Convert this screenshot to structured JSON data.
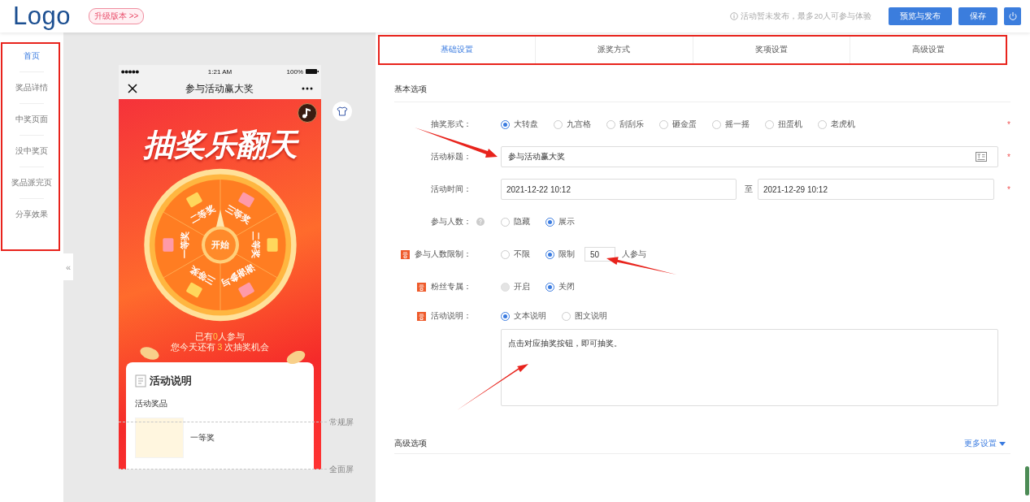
{
  "header": {
    "logo": "Logo",
    "upgrade_badge": "升级版本 >>",
    "notice": "活动暂未发布，最多20人可参与体验",
    "buttons": [
      "预览与发布",
      "保存"
    ]
  },
  "sidebar": {
    "items": [
      {
        "label": "首页",
        "selected": true
      },
      {
        "label": "奖品详情",
        "selected": false
      },
      {
        "label": "中奖页面",
        "selected": false
      },
      {
        "label": "没中奖页",
        "selected": false
      },
      {
        "label": "奖品派完页",
        "selected": false
      },
      {
        "label": "分享效果",
        "selected": false
      }
    ],
    "collapse": "«"
  },
  "preview": {
    "phone": {
      "status_time": "1:21 AM",
      "battery": "100%",
      "title": "参与活动赢大奖",
      "banner_title": "抽奖乐翻天",
      "prizes": [
        "二等奖",
        "三等奖",
        "二等奖",
        "谢谢参与",
        "三等奖",
        "一等奖"
      ],
      "start": "开始",
      "participants": {
        "before": "已有",
        "count": "0",
        "after": "人参与"
      },
      "chances": {
        "before": "您今天还有 ",
        "count": "3",
        "after": " 次抽奖机会"
      },
      "card": {
        "title": "活动说明",
        "subtitle": "活动奖品",
        "prize": "一等奖"
      }
    },
    "screen_marks": [
      "常规屏",
      "全面屏"
    ]
  },
  "tabs": [
    {
      "label": "基础设置",
      "selected": true
    },
    {
      "label": "派奖方式",
      "selected": false
    },
    {
      "label": "奖项设置",
      "selected": false
    },
    {
      "label": "高级设置",
      "selected": false
    }
  ],
  "form": {
    "title": "基本选项",
    "rows": [
      {
        "kind": "radio",
        "label": "抽奖形式：",
        "badge": false,
        "help": false,
        "required_mark": "*",
        "options": [
          {
            "label": "大转盘",
            "selected": true,
            "disabled": false
          },
          {
            "label": "九宫格",
            "selected": false,
            "disabled": false
          },
          {
            "label": "刮刮乐",
            "selected": false,
            "disabled": false
          },
          {
            "label": "砸金蛋",
            "selected": false,
            "disabled": false
          },
          {
            "label": "摇一摇",
            "selected": false,
            "disabled": false
          },
          {
            "label": "扭蛋机",
            "selected": false,
            "disabled": false
          },
          {
            "label": "老虎机",
            "selected": false,
            "disabled": false
          }
        ]
      },
      {
        "kind": "text",
        "label": "活动标题：",
        "badge": false,
        "help": false,
        "required_mark": "*",
        "value": "参与活动赢大奖"
      },
      {
        "kind": "daterange",
        "label": "活动时间：",
        "badge": false,
        "help": false,
        "required_mark": "*",
        "start": "2021-12-22 10:12",
        "separator": "至",
        "end": "2021-12-29 10:12"
      },
      {
        "kind": "radio",
        "label": "参与人数：",
        "badge": false,
        "help": true,
        "options": [
          {
            "label": "隐藏",
            "selected": false,
            "disabled": false
          },
          {
            "label": "展示",
            "selected": true,
            "disabled": false
          }
        ]
      },
      {
        "kind": "radio",
        "label": "参与人数限制：",
        "badge": true,
        "help": false,
        "options": [
          {
            "label": "不限",
            "selected": false,
            "disabled": false
          },
          {
            "label": "限制",
            "selected": true,
            "disabled": false
          }
        ],
        "input": {
          "value": "50",
          "suffix": "人参与"
        }
      },
      {
        "kind": "radio",
        "label": "粉丝专属：",
        "badge": true,
        "help": false,
        "options": [
          {
            "label": "开启",
            "selected": false,
            "disabled": true
          },
          {
            "label": "关闭",
            "selected": true,
            "disabled": false
          }
        ]
      },
      {
        "kind": "radio",
        "label": "活动说明：",
        "badge": true,
        "help": false,
        "options": [
          {
            "label": "文本说明",
            "selected": true,
            "disabled": false
          },
          {
            "label": "图文说明",
            "selected": false,
            "disabled": false
          }
        ],
        "textarea": "点击对应抽奖按钮，即可抽奖。"
      }
    ]
  },
  "advanced": {
    "title": "高级选项",
    "link": "更多设置"
  }
}
